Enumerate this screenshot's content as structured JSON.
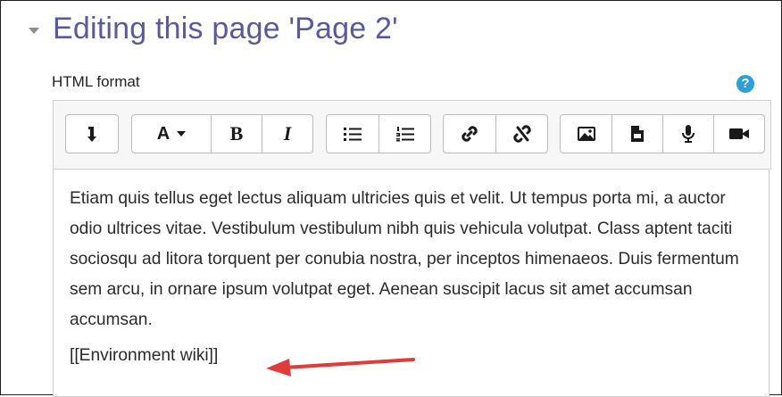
{
  "page": {
    "title": "Editing this page 'Page 2'",
    "format_label": "HTML format",
    "help_glyph": "?"
  },
  "toolbar": {
    "buttons": [
      {
        "name": "toolbar-toggle-button",
        "icon": "arrow-down-icon"
      },
      {
        "name": "font-style-button",
        "glyph": "A",
        "icon": "caret-down-icon"
      },
      {
        "name": "bold-button",
        "glyph": "B"
      },
      {
        "name": "italic-button",
        "glyph": "I"
      },
      {
        "name": "unordered-list-button",
        "icon": "unordered-list-icon"
      },
      {
        "name": "ordered-list-button",
        "icon": "ordered-list-icon"
      },
      {
        "name": "link-button",
        "icon": "link-icon"
      },
      {
        "name": "unlink-button",
        "icon": "unlink-icon"
      },
      {
        "name": "image-button",
        "icon": "image-icon"
      },
      {
        "name": "media-button",
        "icon": "file-icon"
      },
      {
        "name": "record-audio-button",
        "icon": "microphone-icon"
      },
      {
        "name": "record-video-button",
        "icon": "video-camera-icon"
      }
    ]
  },
  "editor": {
    "paragraph": "Etiam quis tellus eget lectus aliquam ultricies quis et velit. Ut tempus porta mi, a auctor odio ultrices vitae. Vestibulum vestibulum nibh quis vehicula volutpat. Class aptent taciti sociosqu ad litora torquent per conubia nostra, per inceptos himenaeos. Duis fermentum sem arcu, in ornare ipsum volutpat eget. Aenean suscipit lacus sit amet accumsan accumsan.",
    "wiki_link": "[[Environment wiki]]"
  },
  "colors": {
    "title": "#5a5a9a",
    "help": "#2b9fd9",
    "annotation_arrow": "#e03c3c"
  }
}
